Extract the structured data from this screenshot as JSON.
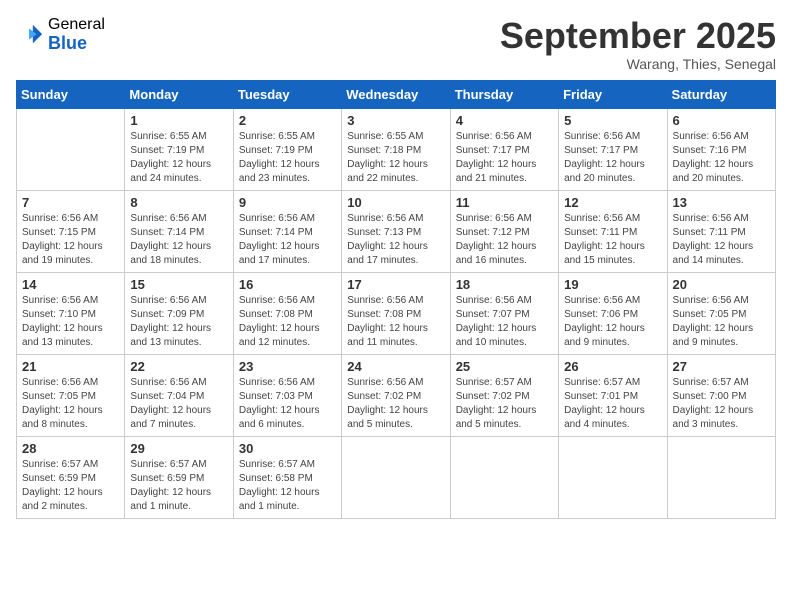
{
  "logo": {
    "general": "General",
    "blue": "Blue"
  },
  "title": "September 2025",
  "location": "Warang, Thies, Senegal",
  "days_of_week": [
    "Sunday",
    "Monday",
    "Tuesday",
    "Wednesday",
    "Thursday",
    "Friday",
    "Saturday"
  ],
  "weeks": [
    [
      {
        "day": "",
        "info": ""
      },
      {
        "day": "1",
        "info": "Sunrise: 6:55 AM\nSunset: 7:19 PM\nDaylight: 12 hours\nand 24 minutes."
      },
      {
        "day": "2",
        "info": "Sunrise: 6:55 AM\nSunset: 7:19 PM\nDaylight: 12 hours\nand 23 minutes."
      },
      {
        "day": "3",
        "info": "Sunrise: 6:55 AM\nSunset: 7:18 PM\nDaylight: 12 hours\nand 22 minutes."
      },
      {
        "day": "4",
        "info": "Sunrise: 6:56 AM\nSunset: 7:17 PM\nDaylight: 12 hours\nand 21 minutes."
      },
      {
        "day": "5",
        "info": "Sunrise: 6:56 AM\nSunset: 7:17 PM\nDaylight: 12 hours\nand 20 minutes."
      },
      {
        "day": "6",
        "info": "Sunrise: 6:56 AM\nSunset: 7:16 PM\nDaylight: 12 hours\nand 20 minutes."
      }
    ],
    [
      {
        "day": "7",
        "info": "Sunrise: 6:56 AM\nSunset: 7:15 PM\nDaylight: 12 hours\nand 19 minutes."
      },
      {
        "day": "8",
        "info": "Sunrise: 6:56 AM\nSunset: 7:14 PM\nDaylight: 12 hours\nand 18 minutes."
      },
      {
        "day": "9",
        "info": "Sunrise: 6:56 AM\nSunset: 7:14 PM\nDaylight: 12 hours\nand 17 minutes."
      },
      {
        "day": "10",
        "info": "Sunrise: 6:56 AM\nSunset: 7:13 PM\nDaylight: 12 hours\nand 17 minutes."
      },
      {
        "day": "11",
        "info": "Sunrise: 6:56 AM\nSunset: 7:12 PM\nDaylight: 12 hours\nand 16 minutes."
      },
      {
        "day": "12",
        "info": "Sunrise: 6:56 AM\nSunset: 7:11 PM\nDaylight: 12 hours\nand 15 minutes."
      },
      {
        "day": "13",
        "info": "Sunrise: 6:56 AM\nSunset: 7:11 PM\nDaylight: 12 hours\nand 14 minutes."
      }
    ],
    [
      {
        "day": "14",
        "info": "Sunrise: 6:56 AM\nSunset: 7:10 PM\nDaylight: 12 hours\nand 13 minutes."
      },
      {
        "day": "15",
        "info": "Sunrise: 6:56 AM\nSunset: 7:09 PM\nDaylight: 12 hours\nand 13 minutes."
      },
      {
        "day": "16",
        "info": "Sunrise: 6:56 AM\nSunset: 7:08 PM\nDaylight: 12 hours\nand 12 minutes."
      },
      {
        "day": "17",
        "info": "Sunrise: 6:56 AM\nSunset: 7:08 PM\nDaylight: 12 hours\nand 11 minutes."
      },
      {
        "day": "18",
        "info": "Sunrise: 6:56 AM\nSunset: 7:07 PM\nDaylight: 12 hours\nand 10 minutes."
      },
      {
        "day": "19",
        "info": "Sunrise: 6:56 AM\nSunset: 7:06 PM\nDaylight: 12 hours\nand 9 minutes."
      },
      {
        "day": "20",
        "info": "Sunrise: 6:56 AM\nSunset: 7:05 PM\nDaylight: 12 hours\nand 9 minutes."
      }
    ],
    [
      {
        "day": "21",
        "info": "Sunrise: 6:56 AM\nSunset: 7:05 PM\nDaylight: 12 hours\nand 8 minutes."
      },
      {
        "day": "22",
        "info": "Sunrise: 6:56 AM\nSunset: 7:04 PM\nDaylight: 12 hours\nand 7 minutes."
      },
      {
        "day": "23",
        "info": "Sunrise: 6:56 AM\nSunset: 7:03 PM\nDaylight: 12 hours\nand 6 minutes."
      },
      {
        "day": "24",
        "info": "Sunrise: 6:56 AM\nSunset: 7:02 PM\nDaylight: 12 hours\nand 5 minutes."
      },
      {
        "day": "25",
        "info": "Sunrise: 6:57 AM\nSunset: 7:02 PM\nDaylight: 12 hours\nand 5 minutes."
      },
      {
        "day": "26",
        "info": "Sunrise: 6:57 AM\nSunset: 7:01 PM\nDaylight: 12 hours\nand 4 minutes."
      },
      {
        "day": "27",
        "info": "Sunrise: 6:57 AM\nSunset: 7:00 PM\nDaylight: 12 hours\nand 3 minutes."
      }
    ],
    [
      {
        "day": "28",
        "info": "Sunrise: 6:57 AM\nSunset: 6:59 PM\nDaylight: 12 hours\nand 2 minutes."
      },
      {
        "day": "29",
        "info": "Sunrise: 6:57 AM\nSunset: 6:59 PM\nDaylight: 12 hours\nand 1 minute."
      },
      {
        "day": "30",
        "info": "Sunrise: 6:57 AM\nSunset: 6:58 PM\nDaylight: 12 hours\nand 1 minute."
      },
      {
        "day": "",
        "info": ""
      },
      {
        "day": "",
        "info": ""
      },
      {
        "day": "",
        "info": ""
      },
      {
        "day": "",
        "info": ""
      }
    ]
  ]
}
